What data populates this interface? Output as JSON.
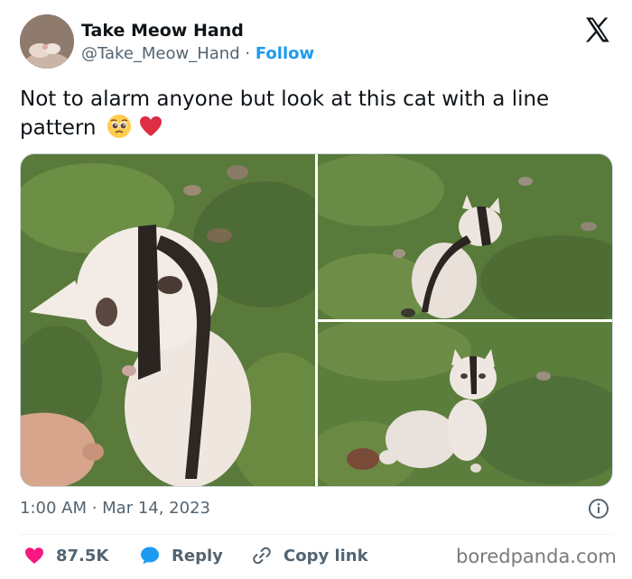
{
  "author": {
    "display_name": "Take Meow Hand",
    "handle": "@Take_Meow_Hand",
    "separator": "·",
    "follow_label": "Follow"
  },
  "tweet": {
    "text": "Not to alarm anyone but look at this cat with a line pattern",
    "emojis": [
      "pleading-face-icon",
      "red-heart-icon"
    ],
    "timestamp": "1:00 AM · Mar 14, 2023"
  },
  "photos": [
    {
      "name": "photo-cat-closeup",
      "description_icon": "photo"
    },
    {
      "name": "photo-cat-sitting-grass",
      "description_icon": "photo"
    },
    {
      "name": "photo-cat-facing-front",
      "description_icon": "photo"
    }
  ],
  "actions": {
    "like_count": "87.5K",
    "reply_label": "Reply",
    "copy_label": "Copy link"
  },
  "watermark": "boredpanda.com",
  "colors": {
    "accent": "#1d9bf0",
    "like": "#f91880",
    "text": "#0f1419",
    "muted": "#536471"
  }
}
